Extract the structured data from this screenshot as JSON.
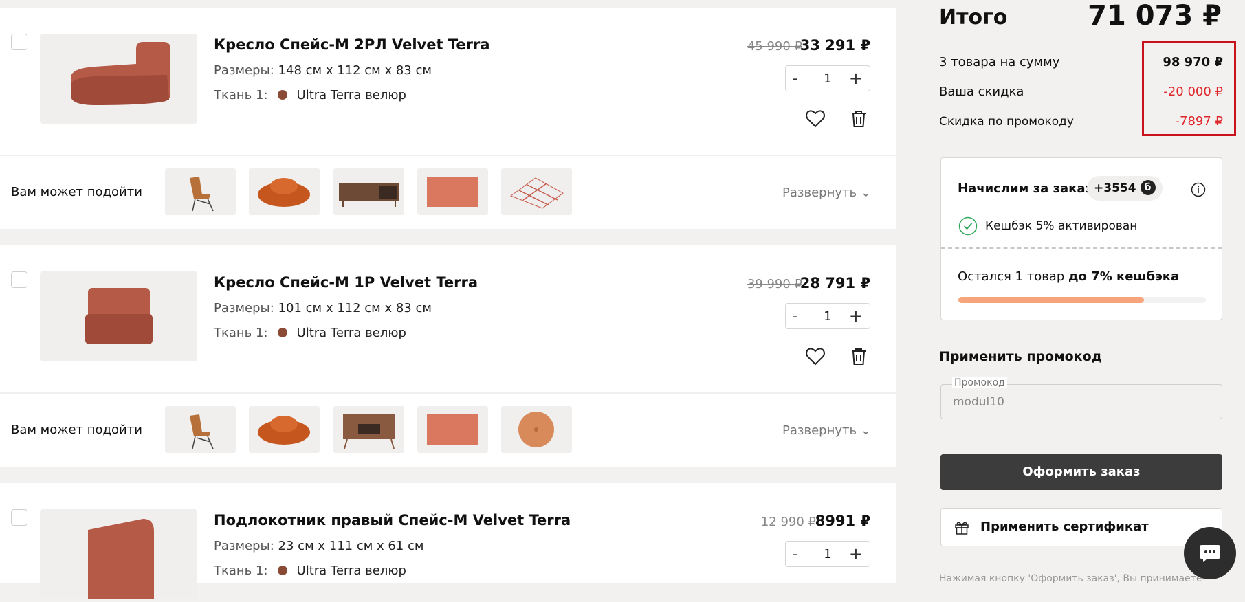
{
  "items": [
    {
      "title": "Кресло Спейс-М 2РЛ Velvet Terra",
      "sizes_label": "Размеры:",
      "sizes_value": "148 см х 112 см х 83 см",
      "fabric_label": "Ткань 1:",
      "fabric_value": "Ultra Terra велюр",
      "old_price": "45 990 ₽",
      "price": "33 291 ₽",
      "qty": "1"
    },
    {
      "title": "Кресло Спейс-М 1Р Velvet Terra",
      "sizes_label": "Размеры:",
      "sizes_value": "101 см х 112 см х 83 см",
      "fabric_label": "Ткань 1:",
      "fabric_value": "Ultra Terra велюр",
      "old_price": "39 990 ₽",
      "price": "28 791 ₽",
      "qty": "1"
    },
    {
      "title": "Подлокотник правый Спейс-М Velvet Terra",
      "sizes_label": "Размеры:",
      "sizes_value": "23 см х 111 см х 61 см",
      "fabric_label": "Ткань 1:",
      "fabric_value": "Ultra Terra велюр",
      "old_price": "12 990 ₽",
      "price": "8991 ₽",
      "qty": "1"
    }
  ],
  "qty_controls": {
    "minus": "-",
    "plus": "+"
  },
  "suggest": {
    "label": "Вам может подойти",
    "expand": "Развернуть"
  },
  "summary": {
    "total_label": "Итого",
    "total_value": "71 073 ₽",
    "goods_label": "3 товара на сумму",
    "goods_value": "98 970 ₽",
    "discount_label": "Ваша скидка",
    "discount_value": "-20 000 ₽",
    "promo_discount_label": "Скидка по промокоду",
    "promo_discount_value": "-7897 ₽"
  },
  "cashback": {
    "title": "Начислим за заказ",
    "points": "+3554",
    "points_icon_letter": "б",
    "activated": "Кешбэк 5% активирован",
    "remaining_prefix": "Остался 1 товар ",
    "remaining_bold": "до 7% кешбэка",
    "progress": 0.75
  },
  "promo": {
    "heading": "Применить промокод",
    "field_label": "Промокод",
    "field_value": "modul10"
  },
  "order_button": "Оформить заказ",
  "certificate_button": "Применить сертификат",
  "disclaimer": "Нажимая кнопку 'Оформить заказ', Вы принимаете",
  "colors": {
    "accent_red": "#e0252b",
    "highlight_border": "#c8131c",
    "fabric_dot": "#8a4a36",
    "progress_fill": "#f6a47b",
    "button_dark": "#3c3c3c"
  }
}
